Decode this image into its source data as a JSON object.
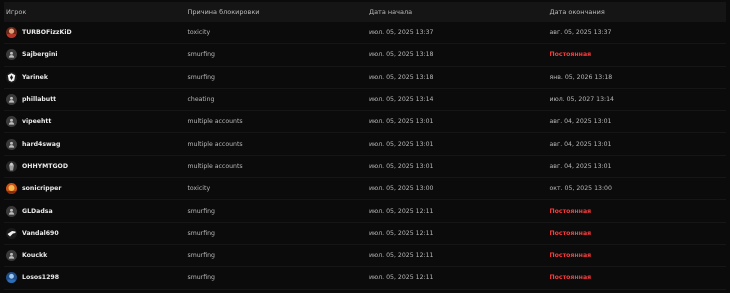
{
  "table": {
    "headers": {
      "player": "Игрок",
      "reason": "Причина блокировки",
      "start": "Дата начала",
      "end": "Дата окончания"
    },
    "rows": [
      {
        "player": "TURBOFizzKiD",
        "avatar": "photo-avatar-red",
        "reason": "toxicity",
        "start": "июл. 05, 2025 13:37",
        "end": "авг. 05, 2025 13:37",
        "permanent": false
      },
      {
        "player": "Sajbergini",
        "avatar": "default-user-icon",
        "reason": "smurfing",
        "start": "июл. 05, 2025 13:18",
        "end": "Постоянная",
        "permanent": true
      },
      {
        "player": "Yarinek",
        "avatar": "white-emblem-avatar",
        "reason": "smurfing",
        "start": "июл. 05, 2025 13:18",
        "end": "янв. 05, 2026 13:18",
        "permanent": false
      },
      {
        "player": "phillabutt",
        "avatar": "default-user-icon",
        "reason": "cheating",
        "start": "июл. 05, 2025 13:14",
        "end": "июл. 05, 2027 13:14",
        "permanent": false
      },
      {
        "player": "vipeehtt",
        "avatar": "default-user-icon",
        "reason": "multiple accounts",
        "start": "июл. 05, 2025 13:01",
        "end": "авг. 04, 2025 13:01",
        "permanent": false
      },
      {
        "player": "hard4swag",
        "avatar": "default-user-icon",
        "reason": "multiple accounts",
        "start": "июл. 05, 2025 13:01",
        "end": "авг. 04, 2025 13:01",
        "permanent": false
      },
      {
        "player": "OHHYMTGOD",
        "avatar": "grey-figure-avatar",
        "reason": "multiple accounts",
        "start": "июл. 05, 2025 13:01",
        "end": "авг. 04, 2025 13:01",
        "permanent": false
      },
      {
        "player": "sonicripper",
        "avatar": "orange-photo-avatar",
        "reason": "toxicity",
        "start": "июл. 05, 2025 13:00",
        "end": "окт. 05, 2025 13:00",
        "permanent": false
      },
      {
        "player": "GLDadsa",
        "avatar": "default-user-icon",
        "reason": "smurfing",
        "start": "июл. 05, 2025 12:11",
        "end": "Постоянная",
        "permanent": true
      },
      {
        "player": "Vandal690",
        "avatar": "white-weapon-avatar",
        "reason": "smurfing",
        "start": "июл. 05, 2025 12:11",
        "end": "Постоянная",
        "permanent": true
      },
      {
        "player": "Kouckk",
        "avatar": "default-user-icon",
        "reason": "smurfing",
        "start": "июл. 05, 2025 12:11",
        "end": "Постоянная",
        "permanent": true
      },
      {
        "player": "Losos1298",
        "avatar": "blue-photo-avatar",
        "reason": "smurfing",
        "start": "июл. 05, 2025 12:11",
        "end": "Постоянная",
        "permanent": true
      }
    ]
  },
  "colors": {
    "background": "#0b0b0b",
    "header_bg": "#151515",
    "permanent": "#ff3b3b"
  }
}
